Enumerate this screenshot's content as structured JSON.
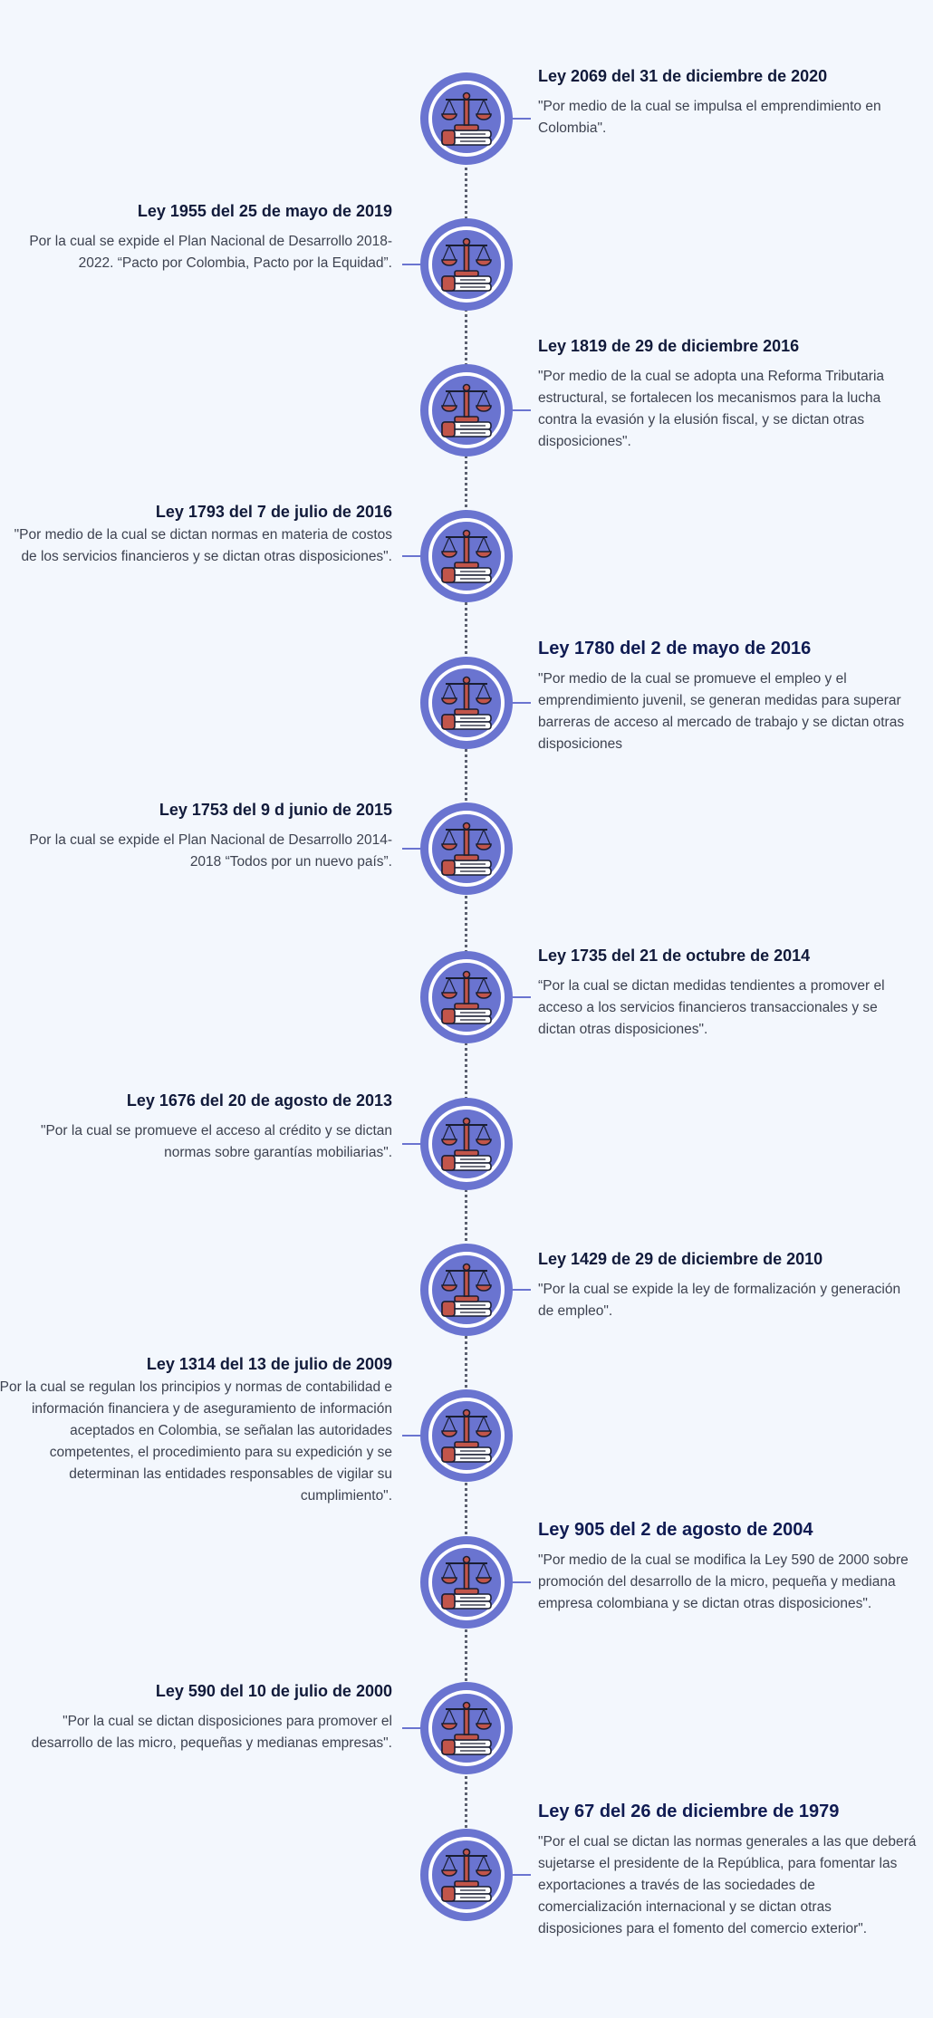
{
  "entries": [
    {
      "title": "Ley 2069 del 31 de diciembre de 2020",
      "text": "\"Por medio de la cual se impulsa el emprendimiento en Colombia\"."
    },
    {
      "title": "Ley 1955 del 25 de mayo de 2019",
      "text": "Por la cual se expide el Plan Nacional de Desarrollo 2018-2022. “Pacto por Colombia, Pacto por la Equidad”."
    },
    {
      "title": "Ley 1819 de 29 de diciembre 2016",
      "text": "\"Por medio de la cual se adopta una Reforma Tributaria estructural, se fortalecen los mecanismos para la lucha contra la evasión y la elusión fiscal, y se dictan otras disposiciones\"."
    },
    {
      "title": "Ley 1793 del 7 de julio de 2016",
      "text": "\"Por medio de la cual se dictan normas en materia de costos de los servicios financieros y se dictan otras disposiciones\"."
    },
    {
      "title": "Ley 1780 del 2 de mayo de 2016",
      "text": "\"Por medio de la cual se promueve el empleo y el emprendimiento juvenil, se generan medidas para superar barreras de acceso al mercado de trabajo y se dictan otras disposiciones"
    },
    {
      "title": "Ley 1753 del 9 d junio de 2015",
      "text": "Por la cual se expide el Plan Nacional de Desarrollo 2014-2018 “Todos por un nuevo país”."
    },
    {
      "title": "Ley 1735 del 21 de octubre de 2014",
      "text": "“Por la cual se dictan medidas tendientes a promover el acceso a los servicios financieros transaccionales y se dictan otras disposiciones\"."
    },
    {
      "title": "Ley 1676 del 20 de agosto de 2013",
      "text": "\"Por la cual se promueve el acceso al crédito y se dictan normas sobre garantías mobiliarias\"."
    },
    {
      "title": "Ley 1429 de 29 de diciembre de 2010",
      "text": "\"Por la cual se expide la ley de formalización y generación de empleo\"."
    },
    {
      "title": "Ley 1314 del 13 de julio de 2009",
      "text": "\"Por la cual se regulan los principios y normas de contabilidad e información financiera y de aseguramiento de información aceptados en Colombia, se señalan las autoridades competentes, el procedimiento para su expedición y se determinan las entidades responsables de vigilar su cumplimiento\"."
    },
    {
      "title": "Ley 905 del 2 de agosto de 2004",
      "text": "\"Por medio de la cual se modifica la Ley 590 de 2000 sobre promoción del desarrollo de la micro, pequeña y mediana empresa colombiana y se dictan otras disposiciones\"."
    },
    {
      "title": "Ley 590 del 10 de julio de 2000",
      "text": "\"Por la cual se dictan disposiciones para promover el desarrollo de las micro, pequeñas y medianas empresas\"."
    },
    {
      "title": "Ley 67 del 26 de diciembre de 1979",
      "text": "\"Por el cual se dictan las normas generales a las que deberá sujetarse el presidente de la República, para fomentar las exportaciones a través de las sociedades de comercialización internacional y se dictan otras disposiciones para el fomento del comercio exterior\"."
    }
  ],
  "icon": "scales-of-justice-icon",
  "colors": {
    "background": "#f3f7fd",
    "node": "#6a74d0",
    "line": "#5b6070",
    "title": "#111a3a",
    "text": "#3d4250"
  }
}
